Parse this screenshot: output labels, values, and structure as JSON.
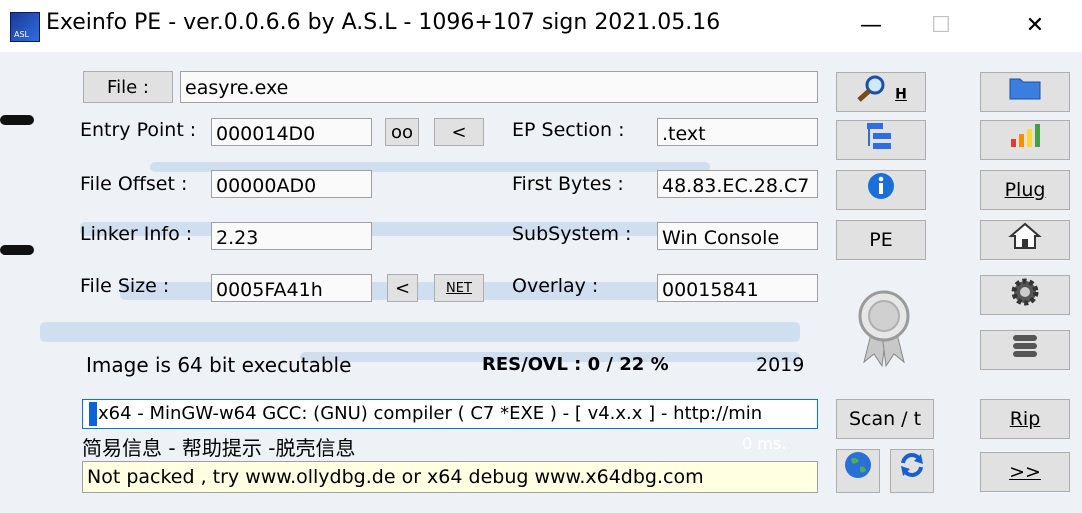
{
  "window": {
    "title": "Exeinfo PE - ver.0.0.6.6  by A.S.L -  1096+107 sign  2021.05.16",
    "icon_text": "ASL",
    "minimize": "—",
    "maximize": "☐",
    "close": "✕"
  },
  "file": {
    "button_label": "File :",
    "path": "easyre.exe"
  },
  "fields": {
    "entry_point_label": "Entry Point :",
    "entry_point": "000014D0",
    "oo_label": "oo",
    "lt_label": "<",
    "ep_section_label": "EP Section :",
    "ep_section": ".text",
    "file_offset_label": "File Offset :",
    "file_offset": "00000AD0",
    "first_bytes_label": "First Bytes :",
    "first_bytes": "48.83.EC.28.C7",
    "linker_info_label": "Linker Info :",
    "linker_info": "2.23",
    "subsystem_label": "SubSystem :",
    "subsystem": "Win Console",
    "file_size_label": "File Size :",
    "file_size": "0005FA41h",
    "lt2_label": "<",
    "net_label": "NET",
    "overlay_label": "Overlay :",
    "overlay": "00015841"
  },
  "status": {
    "image_bits": "Image is 64 bit executable",
    "res_ovl": "RES/OVL : 0 / 22 %",
    "year": "2019",
    "detection": "x64 - MinGW-w64 GCC: (GNU) compiler ( C7 *EXE ) - [ v4.x.x ]  - http://min",
    "chinese_links": "简易信息 - 帮助提示 -脱壳信息",
    "timing": "0 ms.",
    "hint": "Not packed , try  www.ollydbg.de or x64 debug www.x64dbg.com"
  },
  "middle_buttons": {
    "search_h": "H",
    "pe": "PE",
    "scan": "Scan / t"
  },
  "right_buttons": {
    "plug": "Plug",
    "rip": "Rip",
    "more": ">>"
  },
  "colors": {
    "accent": "#0078d7",
    "hint_bg": "#ffffe1",
    "field_bg": "#fafafa"
  }
}
